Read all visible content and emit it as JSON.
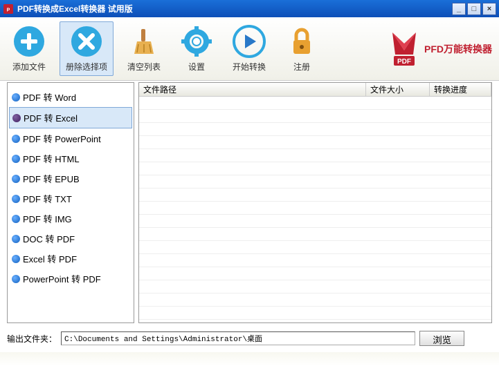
{
  "title": "PDF转换成Excel转换器 试用版",
  "window_controls": {
    "min": "_",
    "max": "□",
    "close": "×"
  },
  "toolbar": [
    {
      "id": "add",
      "label": "添加文件"
    },
    {
      "id": "remove",
      "label": "册除选择项"
    },
    {
      "id": "clear",
      "label": "清空列表"
    },
    {
      "id": "settings",
      "label": "设置"
    },
    {
      "id": "start",
      "label": "开始转换"
    },
    {
      "id": "register",
      "label": "注册"
    }
  ],
  "logo_text": "PFD万能转换器",
  "logo_sub": "PDF",
  "sidebar": [
    {
      "label": "PDF 转 Word"
    },
    {
      "label": "PDF 转 Excel",
      "selected": true
    },
    {
      "label": "PDF 转 PowerPoint"
    },
    {
      "label": "PDF 转 HTML"
    },
    {
      "label": "PDF 转 EPUB"
    },
    {
      "label": "PDF 转 TXT"
    },
    {
      "label": "PDF 转 IMG"
    },
    {
      "label": "DOC 转 PDF"
    },
    {
      "label": "Excel 转 PDF"
    },
    {
      "label": "PowerPoint 转 PDF"
    }
  ],
  "columns": {
    "path": "文件路径",
    "size": "文件大小",
    "progress": "转换进度"
  },
  "output": {
    "label": "输出文件夹：",
    "value": "C:\\Documents and Settings\\Administrator\\桌面",
    "browse": "浏览"
  }
}
